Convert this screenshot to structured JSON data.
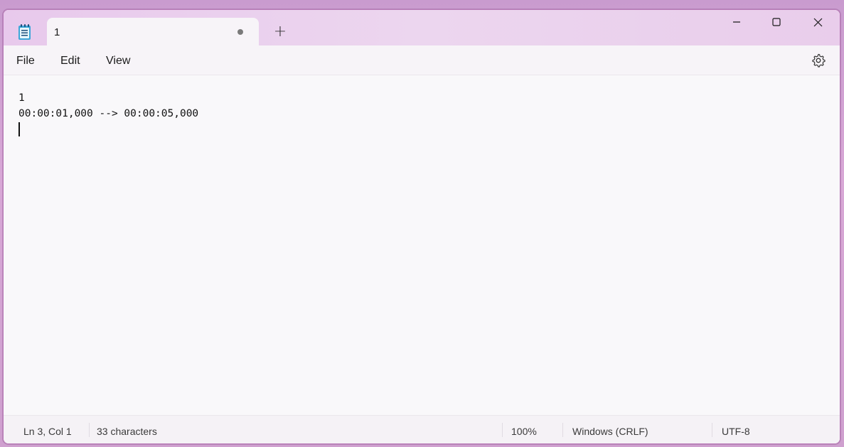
{
  "tab": {
    "title": "1",
    "unsaved": true
  },
  "new_tab_symbol": "+",
  "menu": {
    "file": "File",
    "edit": "Edit",
    "view": "View"
  },
  "editor": {
    "lines": [
      "1",
      "00:00:01,000 --> 00:00:05,000",
      ""
    ]
  },
  "status": {
    "position": "Ln 3, Col 1",
    "characters": "33 characters",
    "zoom": "100%",
    "line_endings": "Windows (CRLF)",
    "encoding": "UTF-8"
  },
  "icons": {
    "app": "notepad-icon",
    "settings": "gear-icon",
    "minimize": "minimize-icon",
    "maximize": "maximize-icon",
    "close": "close-icon"
  },
  "colors": {
    "titlebar": "#ecd6ef",
    "editor_bg": "#f9f8fa",
    "unsaved_dot": "#7a7a7a"
  }
}
